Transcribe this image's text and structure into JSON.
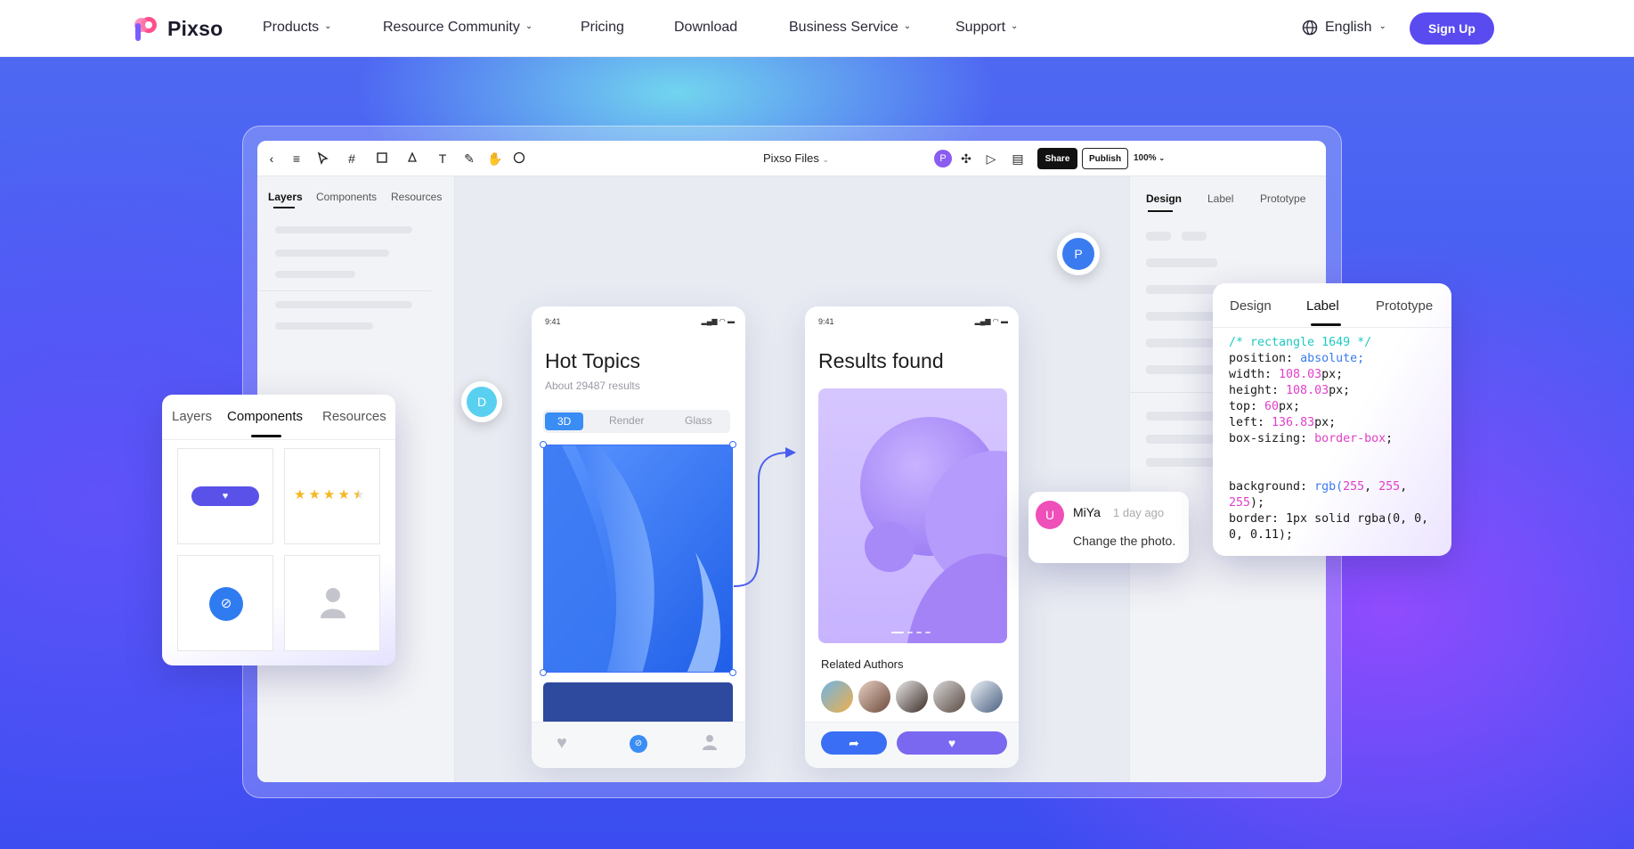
{
  "nav": {
    "logo": "Pixso",
    "items": [
      {
        "label": "Products",
        "dropdown": true
      },
      {
        "label": "Resource Community",
        "dropdown": true
      },
      {
        "label": "Pricing",
        "dropdown": false
      },
      {
        "label": "Download",
        "dropdown": false
      },
      {
        "label": "Business Service",
        "dropdown": true
      },
      {
        "label": "Support",
        "dropdown": true
      }
    ],
    "language": "English",
    "signup": "Sign Up"
  },
  "editor": {
    "file_title": "Pixso Files",
    "share_label": "Share",
    "publish_label": "Publish",
    "zoom": "100%",
    "user_initial": "P",
    "left_tabs": [
      "Layers",
      "Components",
      "Resources"
    ],
    "right_tabs": [
      "Design",
      "Label",
      "Prototype"
    ]
  },
  "components_card": {
    "tabs": [
      "Layers",
      "Components",
      "Resources"
    ],
    "active_tab": "Components",
    "rating": 4.5
  },
  "phone1": {
    "time": "9:41",
    "title": "Hot Topics",
    "subtitle": "About 29487 results",
    "segments": [
      "3D",
      "Render",
      "Glass"
    ]
  },
  "phone2": {
    "time": "9:41",
    "title": "Results found",
    "related": "Related Authors"
  },
  "comment": {
    "initial": "U",
    "author": "MiYa",
    "time": "1 day ago",
    "text": "Change the photo."
  },
  "collaborators": {
    "d": "D",
    "p": "P"
  },
  "code_card": {
    "tabs": [
      "Design",
      "Label",
      "Prototype"
    ],
    "active_tab": "Label",
    "css": {
      "comment": "/* rectangle 1649 */",
      "position": "absolute",
      "width": "108.03",
      "height": "108.03",
      "top": "60",
      "left": "136.83",
      "box_sizing": "border-box",
      "background": [
        "255",
        "255",
        "255"
      ],
      "border": "1px solid rgba(0, 0, 0, 0.11);"
    }
  },
  "colors": {
    "brand": "#5a4bf0",
    "selection": "#3a6ff5",
    "accent_purple": "#7a68f0"
  }
}
